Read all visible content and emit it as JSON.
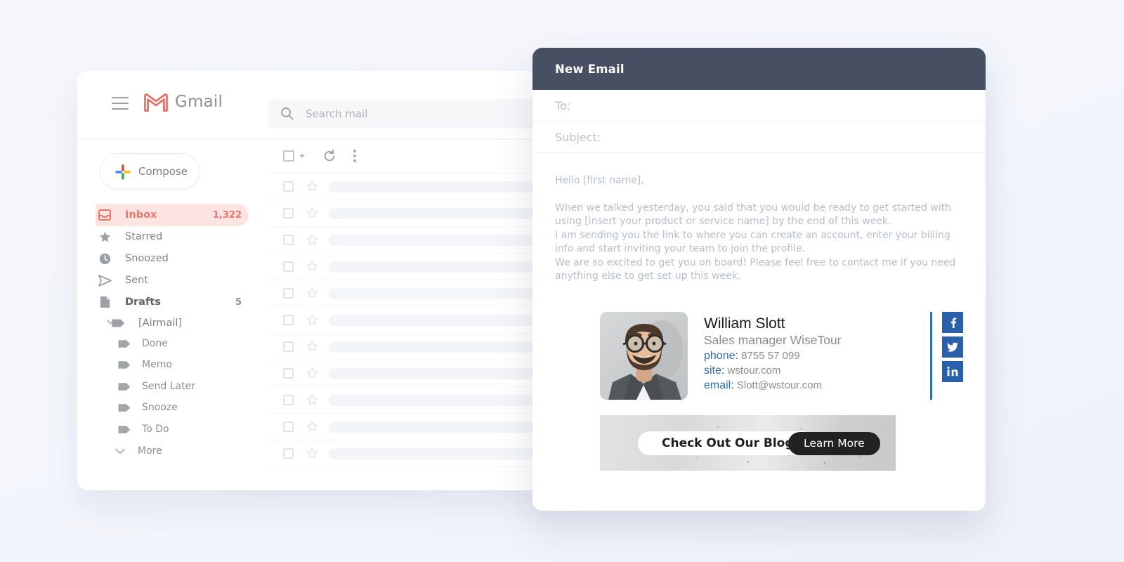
{
  "theme": {
    "page_background": "#f5f7fc",
    "compose_header_bg": "#474f63",
    "gmail_accent": "#e8776c",
    "inbox_pill_bg": "#fbe4e1",
    "signature_link_blue": "#2d6cb5",
    "social_icon_bg": "#2a5faa"
  },
  "gmail": {
    "brand": "Gmail",
    "menu_icon": "hamburger-icon",
    "logo_icon": "gmail-logo-icon",
    "search": {
      "icon": "search-icon",
      "placeholder": "Search mail",
      "value": ""
    },
    "compose": {
      "label": "Compose",
      "icon": "plus-icon"
    },
    "nav": [
      {
        "label": "Inbox",
        "icon": "inbox-icon",
        "count": "1,322",
        "active": true,
        "bold": false
      },
      {
        "label": "Starred",
        "icon": "star-icon",
        "count": "",
        "active": false,
        "bold": false
      },
      {
        "label": "Snoozed",
        "icon": "clock-icon",
        "count": "",
        "active": false,
        "bold": false
      },
      {
        "label": "Sent",
        "icon": "send-icon",
        "count": "",
        "active": false,
        "bold": false
      },
      {
        "label": "Drafts",
        "icon": "draft-icon",
        "count": "5",
        "active": false,
        "bold": true
      }
    ],
    "group": {
      "label": "[Airmail]",
      "icon": "label-icon",
      "expanded": true,
      "caret_icon": "caret-down-icon",
      "children": [
        {
          "label": "Done",
          "icon": "label-icon"
        },
        {
          "label": "Memo",
          "icon": "label-icon"
        },
        {
          "label": "Send Later",
          "icon": "label-icon"
        },
        {
          "label": "Snooze",
          "icon": "label-icon"
        },
        {
          "label": "To Do",
          "icon": "label-icon"
        }
      ]
    },
    "more": {
      "label": "More",
      "icon": "chevron-down-icon"
    },
    "list_toolbar": {
      "select_all_icon": "checkbox-icon",
      "select_all_caret_icon": "caret-down-icon",
      "refresh_icon": "refresh-icon",
      "overflow_icon": "more-vertical-icon"
    },
    "mail_rows_count": 11
  },
  "compose": {
    "title": "New Email",
    "fields": [
      {
        "label": "To:",
        "value": "",
        "name": "to-field"
      },
      {
        "label": "Subject:",
        "value": "",
        "name": "subject-field"
      }
    ],
    "body": {
      "greeting": "Hello [first name],",
      "paragraphs": [
        "When we talked yesterday, you said that you would be ready to get started with using [insert your product or service name] by the end of this week.",
        "I am sending you the link to where you can create an account, enter your billing info and start inviting your team to join the profile.",
        "We are so excited to get you on board! Please feel free to contact me if you need anything else to get set up this week."
      ]
    },
    "signature": {
      "photo_alt": "portrait of bearded man with glasses in gray suit",
      "name": "William Slott",
      "role": "Sales manager WiseTour",
      "details": [
        {
          "key": "phone:",
          "value": "8755 57 099"
        },
        {
          "key": "site:",
          "value": "wstour.com"
        },
        {
          "key": "email:",
          "value": "Slott@wstour.com"
        }
      ],
      "social": [
        {
          "name": "facebook-icon",
          "label": "f"
        },
        {
          "name": "twitter-icon",
          "label": "t"
        },
        {
          "name": "linkedin-icon",
          "label": "in"
        }
      ]
    },
    "banner": {
      "pill_label": "Check Out Our Blog",
      "cta_label": "Learn More"
    }
  }
}
